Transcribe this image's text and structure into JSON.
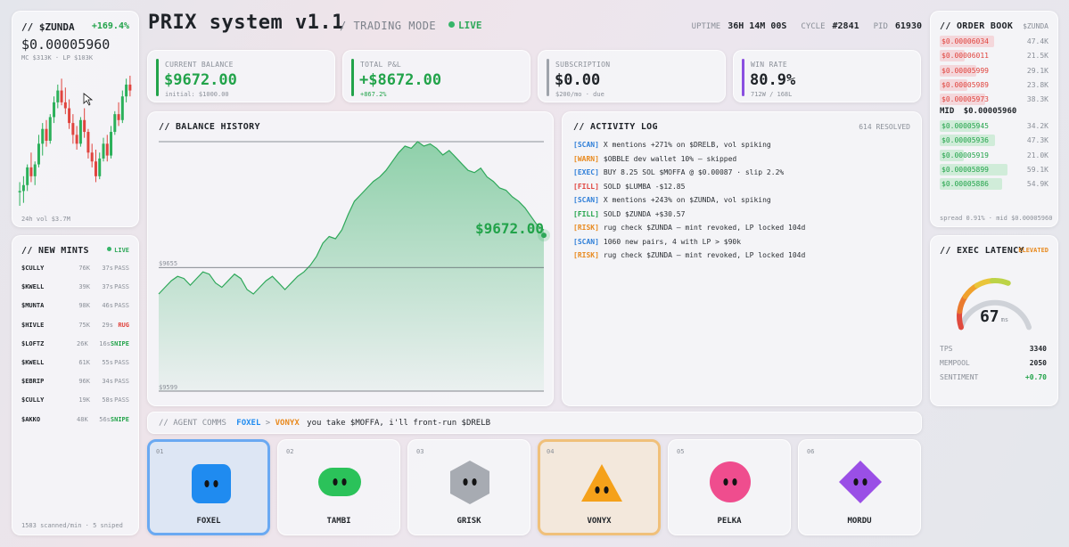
{
  "header": {
    "title": "PRIX system v1.1",
    "mode": "/ TRADING MODE",
    "live": "LIVE",
    "uptime_label": "UPTIME",
    "uptime": "36H 14M 00S",
    "cycle_label": "CYCLE",
    "cycle": "#2841",
    "pid_label": "PID",
    "pid": "61930"
  },
  "token": {
    "name": "// $ZUNDA",
    "change": "+169.4%",
    "price": "$0.00005960",
    "meta": "MC $313K · LP $103K",
    "volume": "24h vol $3.7M",
    "candles": [
      [
        6.0,
        6.3,
        5.5,
        6.0
      ],
      [
        6.0,
        6.5,
        5.6,
        6.2
      ],
      [
        6.2,
        6.9,
        6.0,
        6.8
      ],
      [
        6.8,
        7.3,
        6.3,
        6.5
      ],
      [
        6.5,
        7.0,
        6.2,
        6.9
      ],
      [
        6.9,
        7.9,
        6.8,
        7.6
      ],
      [
        7.6,
        8.3,
        7.2,
        8.1
      ],
      [
        8.1,
        8.4,
        7.5,
        7.7
      ],
      [
        7.7,
        8.6,
        7.6,
        8.5
      ],
      [
        8.5,
        9.2,
        8.3,
        9.0
      ],
      [
        9.0,
        9.6,
        8.8,
        9.4
      ],
      [
        9.4,
        9.8,
        8.9,
        9.0
      ],
      [
        9.0,
        9.5,
        8.6,
        8.8
      ],
      [
        8.8,
        9.1,
        8.1,
        8.3
      ],
      [
        8.3,
        8.6,
        7.6,
        7.9
      ],
      [
        7.9,
        8.2,
        7.4,
        7.6
      ],
      [
        7.6,
        8.5,
        7.5,
        8.4
      ],
      [
        8.4,
        8.8,
        7.8,
        8.0
      ],
      [
        8.0,
        8.1,
        7.1,
        7.3
      ],
      [
        7.3,
        7.6,
        6.8,
        7.0
      ],
      [
        7.0,
        7.4,
        6.3,
        6.5
      ],
      [
        6.5,
        7.3,
        6.4,
        7.1
      ],
      [
        7.1,
        7.8,
        7.0,
        7.6
      ],
      [
        7.6,
        7.9,
        7.0,
        7.2
      ],
      [
        7.2,
        8.2,
        7.1,
        8.0
      ],
      [
        8.0,
        8.7,
        7.9,
        8.6
      ],
      [
        8.6,
        9.0,
        8.2,
        8.4
      ],
      [
        8.4,
        9.4,
        8.3,
        9.2
      ],
      [
        9.2,
        9.8,
        9.0,
        9.6
      ],
      [
        9.6,
        9.9,
        9.2,
        9.4
      ]
    ]
  },
  "mints": {
    "title": "// NEW MINTS",
    "live": "LIVE",
    "rows": [
      {
        "sym": "$CULLY",
        "mc": "76K",
        "age": "37s",
        "status": "PASS"
      },
      {
        "sym": "$KWELL",
        "mc": "39K",
        "age": "37s",
        "status": "PASS"
      },
      {
        "sym": "$MUNTA",
        "mc": "98K",
        "age": "46s",
        "status": "PASS"
      },
      {
        "sym": "$HIVLE",
        "mc": "75K",
        "age": "29s",
        "status": "RUG"
      },
      {
        "sym": "$LOFTZ",
        "mc": "26K",
        "age": "16s",
        "status": "SNIPE"
      },
      {
        "sym": "$KWELL",
        "mc": "61K",
        "age": "55s",
        "status": "PASS"
      },
      {
        "sym": "$EBRIP",
        "mc": "96K",
        "age": "34s",
        "status": "PASS"
      },
      {
        "sym": "$CULLY",
        "mc": "19K",
        "age": "58s",
        "status": "PASS"
      },
      {
        "sym": "$AKKO",
        "mc": "48K",
        "age": "56s",
        "status": "SNIPE"
      }
    ],
    "footer": "1583 scanned/min · 5 sniped"
  },
  "cards": [
    {
      "label": "CURRENT BALANCE",
      "value": "$9672.00",
      "sub": "initial: $1000.00",
      "color": "#22a34a"
    },
    {
      "label": "TOTAL P&L",
      "value": "+$8672.00",
      "sub": "+867.2%",
      "color": "#22a34a"
    },
    {
      "label": "SUBSCRIPTION",
      "value": "$0.00",
      "sub": "$200/mo · due",
      "color": "#9ea3ab"
    },
    {
      "label": "WIN RATE",
      "value": "80.9%",
      "sub": "712W / 168L",
      "color": "#8a4fe0"
    }
  ],
  "balance": {
    "title": "// BALANCE HISTORY",
    "current": "$9672.00",
    "ref_label": "$9655",
    "low_label": "$9599",
    "ylim": [
      9599,
      9712
    ],
    "ref": 9655,
    "values": [
      9643,
      9646,
      9649,
      9651,
      9650,
      9647,
      9650,
      9653,
      9652,
      9648,
      9646,
      9649,
      9652,
      9650,
      9645,
      9643,
      9646,
      9649,
      9651,
      9648,
      9645,
      9648,
      9651,
      9653,
      9656,
      9660,
      9666,
      9669,
      9668,
      9672,
      9679,
      9685,
      9688,
      9691,
      9694,
      9696,
      9699,
      9703,
      9707,
      9710,
      9709,
      9712,
      9710,
      9711,
      9709,
      9706,
      9708,
      9705,
      9702,
      9699,
      9698,
      9700,
      9696,
      9694,
      9691,
      9690,
      9687,
      9685,
      9682,
      9678,
      9674,
      9672
    ]
  },
  "activity": {
    "title": "// ACTIVITY LOG",
    "resolved": "614 RESOLVED",
    "lines": [
      {
        "tag": "[SCAN]",
        "type": "scan",
        "text": "X mentions +271% on $DRELB, vol spiking"
      },
      {
        "tag": "[WARN]",
        "type": "warn",
        "text": "$OBBLE dev wallet 10% — skipped"
      },
      {
        "tag": "[EXEC]",
        "type": "exec",
        "text": "BUY 8.25 SOL $MOFFA @ $0.00087 · slip 2.2%"
      },
      {
        "tag": "[FILL]",
        "type": "fillred",
        "text": "SOLD $LUMBA -$12.85"
      },
      {
        "tag": "[SCAN]",
        "type": "scan",
        "text": "X mentions +243% on $ZUNDA, vol spiking"
      },
      {
        "tag": "[FILL]",
        "type": "fillgreen",
        "text": "SOLD $ZUNDA +$30.57"
      },
      {
        "tag": "[RISK]",
        "type": "risk",
        "text": "rug check $ZUNDA — mint revoked, LP locked 104d"
      },
      {
        "tag": "[SCAN]",
        "type": "scan",
        "text": "1060 new pairs, 4 with LP > $90k"
      },
      {
        "tag": "[RISK]",
        "type": "risk",
        "text": "rug check $ZUNDA — mint revoked, LP locked 104d"
      }
    ]
  },
  "comms": {
    "label": "// AGENT COMMS",
    "from": "FOXEL",
    "arrow": ">",
    "to": "VONYX",
    "message": "you take $MOFFA, i'll front-run $DRELB"
  },
  "agents": [
    {
      "num": "01",
      "name": "FOXEL",
      "shape": "rounded-square",
      "color": "#1f8bf0",
      "active": "blue"
    },
    {
      "num": "02",
      "name": "TAMBI",
      "shape": "pill",
      "color": "#2bc25a",
      "active": ""
    },
    {
      "num": "03",
      "name": "GRISK",
      "shape": "hexagon",
      "color": "#a7abb2",
      "active": ""
    },
    {
      "num": "04",
      "name": "VONYX",
      "shape": "triangle",
      "color": "#f5a11a",
      "active": "orange"
    },
    {
      "num": "05",
      "name": "PELKA",
      "shape": "circle",
      "color": "#ef4d8e",
      "active": ""
    },
    {
      "num": "06",
      "name": "MORDU",
      "shape": "diamond",
      "color": "#9a4fe6",
      "active": ""
    }
  ],
  "orderbook": {
    "title": "// ORDER BOOK",
    "pair": "$ZUNDA",
    "asks": [
      {
        "price": "$0.00006034",
        "size": "47.4K",
        "depth": 0.78
      },
      {
        "price": "$0.00006011",
        "size": "21.5K",
        "depth": 0.36
      },
      {
        "price": "$0.00005999",
        "size": "29.1K",
        "depth": 0.52
      },
      {
        "price": "$0.00005989",
        "size": "23.8K",
        "depth": 0.4
      },
      {
        "price": "$0.00005973",
        "size": "38.3K",
        "depth": 0.66
      }
    ],
    "mid_label": "MID",
    "mid": "$0.00005960",
    "bids": [
      {
        "price": "$0.00005945",
        "size": "34.2K",
        "depth": 0.58
      },
      {
        "price": "$0.00005936",
        "size": "47.3K",
        "depth": 0.8
      },
      {
        "price": "$0.00005919",
        "size": "21.0K",
        "depth": 0.34
      },
      {
        "price": "$0.00005899",
        "size": "59.1K",
        "depth": 0.98
      },
      {
        "price": "$0.00005886",
        "size": "54.9K",
        "depth": 0.9
      }
    ],
    "footer": "spread 0.91% · mid $0.00005960"
  },
  "latency": {
    "title": "// EXEC LATENCY",
    "status": "ELEVATED",
    "value": "67",
    "unit": "ms",
    "level": 0.6,
    "tps_label": "TPS",
    "tps": "3340",
    "mempool_label": "MEMPOOL",
    "mempool": "2050",
    "sentiment_label": "SENTIMENT",
    "sentiment": "+0.70"
  }
}
